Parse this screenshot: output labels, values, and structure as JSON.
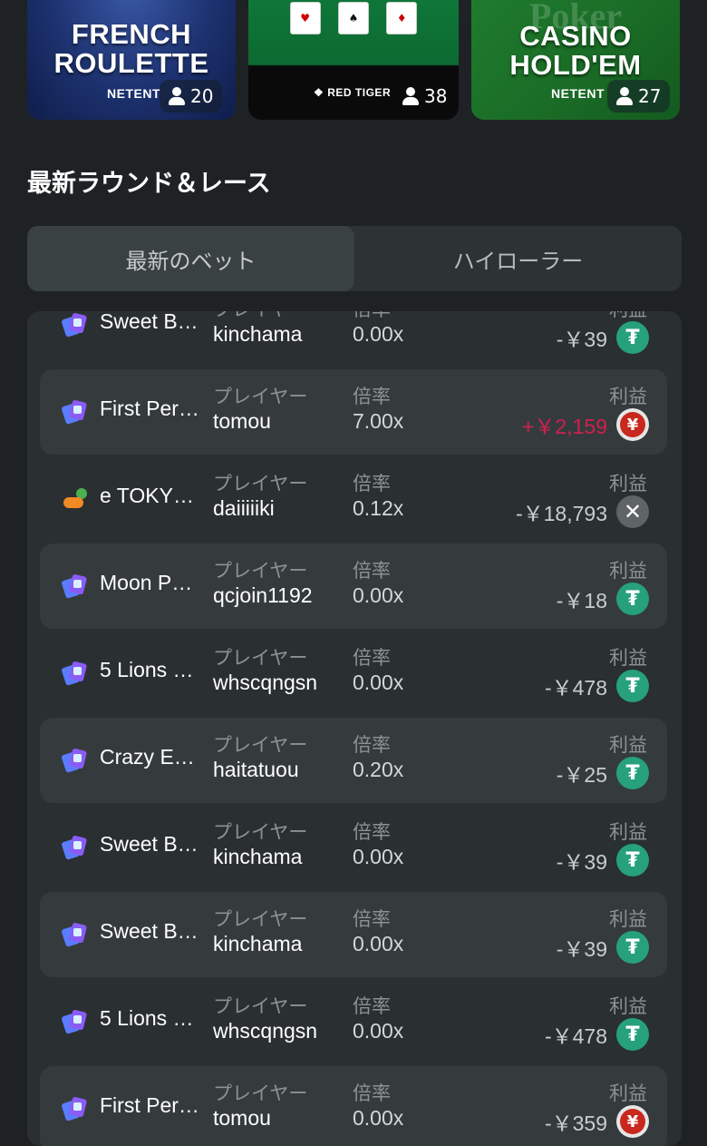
{
  "games": [
    {
      "title_line1": "FRENCH",
      "title_line2": "ROULETTE",
      "provider": "NETENT",
      "players": "20"
    },
    {
      "provider": "RED TIGER",
      "players": "38"
    },
    {
      "title_bg": "Poker",
      "title_line1": "CASINO",
      "title_line2": "HOLD'EM",
      "provider": "NETENT",
      "players": "27"
    }
  ],
  "section_title": "最新ラウンド＆レース",
  "tabs": [
    {
      "label": "最新のベット",
      "active": true
    },
    {
      "label": "ハイローラー",
      "active": false
    }
  ],
  "labels": {
    "player": "プレイヤー",
    "multiplier": "倍率",
    "profit": "利益"
  },
  "bets": [
    {
      "game": "Sweet B…",
      "icon": "slot-icon",
      "player": "kinchama",
      "multiplier": "0.00x",
      "profit": "-￥39",
      "coin": "usdt-icon",
      "win": false
    },
    {
      "game": "First Per…",
      "icon": "slot-icon",
      "player": "tomou",
      "multiplier": "7.00x",
      "profit": "+￥2,159",
      "coin": "jpy-icon",
      "win": true
    },
    {
      "game": "e TOKY…",
      "icon": "original-game-icon",
      "player": "daiiiiiki",
      "multiplier": "0.12x",
      "profit": "-￥18,793",
      "coin": "xrp-icon",
      "win": false
    },
    {
      "game": "Moon P…",
      "icon": "slot-icon",
      "player": "qcjoin1192",
      "multiplier": "0.00x",
      "profit": "-￥18",
      "coin": "usdt-icon",
      "win": false
    },
    {
      "game": "5 Lions …",
      "icon": "slot-icon",
      "player": "whscqngsn",
      "multiplier": "0.00x",
      "profit": "-￥478",
      "coin": "usdt-icon",
      "win": false
    },
    {
      "game": "Crazy E…",
      "icon": "slot-icon",
      "player": "haitatuou",
      "multiplier": "0.20x",
      "profit": "-￥25",
      "coin": "usdt-icon",
      "win": false
    },
    {
      "game": "Sweet B…",
      "icon": "slot-icon",
      "player": "kinchama",
      "multiplier": "0.00x",
      "profit": "-￥39",
      "coin": "usdt-icon",
      "win": false
    },
    {
      "game": "Sweet B…",
      "icon": "slot-icon",
      "player": "kinchama",
      "multiplier": "0.00x",
      "profit": "-￥39",
      "coin": "usdt-icon",
      "win": false
    },
    {
      "game": "5 Lions …",
      "icon": "slot-icon",
      "player": "whscqngsn",
      "multiplier": "0.00x",
      "profit": "-￥478",
      "coin": "usdt-icon",
      "win": false
    },
    {
      "game": "First Per…",
      "icon": "slot-icon",
      "player": "tomou",
      "multiplier": "0.00x",
      "profit": "-￥359",
      "coin": "jpy-icon",
      "win": false
    }
  ],
  "colors": {
    "background": "#1f2224",
    "row_alt": "#353b3d",
    "win": "#d21f4f",
    "usdt": "#26a17b"
  }
}
